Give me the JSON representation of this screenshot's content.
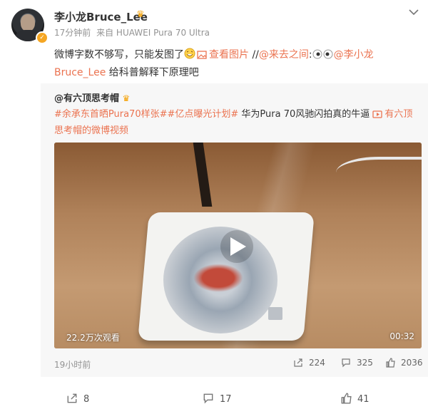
{
  "post": {
    "author": "李小龙Bruce_Lee",
    "time": "17分钟前",
    "source": "来自 HUAWEI Pura 70 Ultra",
    "text_1": "微博字数不够写，只能发图了",
    "view_image": "查看图片",
    "slashes": " //",
    "mention_1": "@来去之间",
    "colon": ":",
    "mention_2": "@李小龙Bruce_Lee",
    "text_2": " 给科普解释下原理吧"
  },
  "repost": {
    "author": "@有六顶思考帽",
    "hashtag_1": "#余承东首晒Pura70样张#",
    "hashtag_2": "#亿点曝光计划#",
    "text": " 华为Pura 70风驰闪拍真的牛逼 ",
    "video_link": "有六顶思考帽的微博视频",
    "video": {
      "views": "22.2万次观看",
      "duration": "00:32"
    },
    "time": "19小时前",
    "stats": {
      "reposts": "224",
      "comments": "325",
      "likes": "2036"
    }
  },
  "bottom_bar": {
    "reposts": "8",
    "comments": "17",
    "likes": "41"
  },
  "colors": {
    "link": "#eb7350",
    "badge": "#f5a623"
  },
  "icons": [
    "avatar-verified-badge",
    "crown-icon",
    "chevron-down-icon",
    "laugh-emoji-icon",
    "image-icon",
    "video-icon",
    "play-icon",
    "share-icon",
    "comment-icon",
    "like-icon"
  ]
}
